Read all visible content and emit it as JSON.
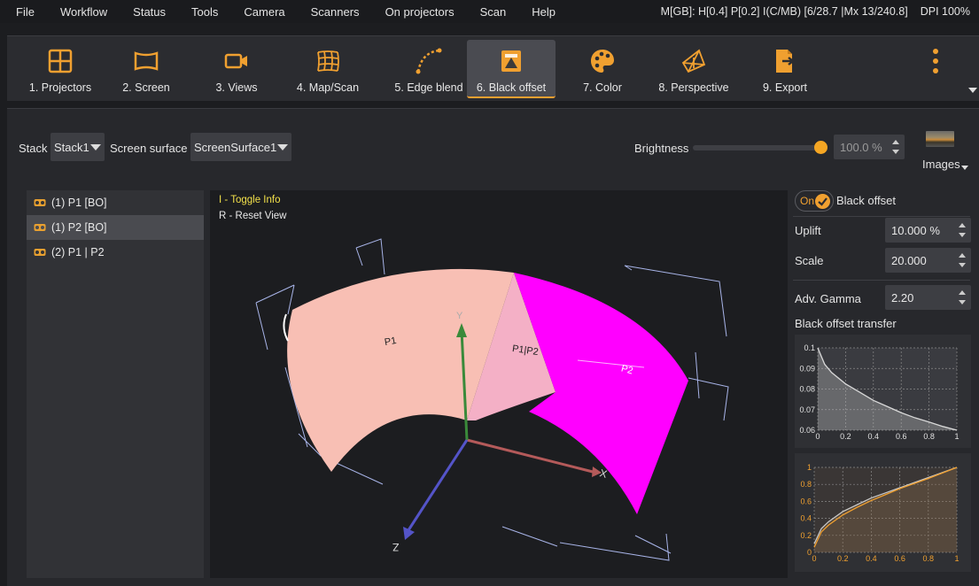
{
  "menu": [
    "File",
    "Workflow",
    "Status",
    "Tools",
    "Camera",
    "Scanners",
    "On projectors",
    "Scan",
    "Help"
  ],
  "stats": {
    "mem": "M[GB]: H[0.4] P[0.2] I(C/MB) [6/28.7 |Mx 13/240.8]",
    "dpi": "DPI 100%"
  },
  "tools": [
    {
      "label": "1. Projectors",
      "icon": "projectors-grid-icon"
    },
    {
      "label": "2. Screen",
      "icon": "screen-icon"
    },
    {
      "label": "3. Views",
      "icon": "video-camera-icon"
    },
    {
      "label": "4. Map/Scan",
      "icon": "mesh-grid-icon"
    },
    {
      "label": "5. Edge blend",
      "icon": "edge-blend-curve-icon"
    },
    {
      "label": "6. Black offset",
      "icon": "black-offset-icon"
    },
    {
      "label": "7. Color",
      "icon": "palette-icon"
    },
    {
      "label": "8. Perspective",
      "icon": "perspective-icon"
    },
    {
      "label": "9. Export",
      "icon": "export-icon"
    }
  ],
  "active_tool": 5,
  "stack": {
    "label": "Stack",
    "value": "Stack1"
  },
  "screen_surface": {
    "label": "Screen surface",
    "value": "ScreenSurface1"
  },
  "brightness": {
    "label": "Brightness",
    "value": "100.0 %",
    "level": 1.0
  },
  "images_label": "Images",
  "list_items": [
    "(1) P1 [BO]",
    "(1) P2 [BO]",
    "(2) P1 | P2"
  ],
  "selected_item": 1,
  "viewport": {
    "info1": "I - Toggle Info",
    "info2": "R - Reset View",
    "labels": [
      "P1",
      "P1|P2",
      "P2"
    ],
    "axes": [
      "Y",
      "X",
      "Z"
    ]
  },
  "black_offset": {
    "toggle": "On",
    "label": "Black offset"
  },
  "uplift": {
    "label": "Uplift",
    "value": "10.000 %"
  },
  "scale": {
    "label": "Scale",
    "value": "20.000"
  },
  "adv_gamma": {
    "label": "Adv. Gamma",
    "value": "2.20"
  },
  "transfer_title": "Black offset transfer",
  "colors": {
    "accent": "#f0a030",
    "p1": "#f8bfb4",
    "p12": "#f4b0c6",
    "p2": "#ff00ff"
  },
  "chart_data": [
    {
      "type": "line",
      "ylim": [
        0.06,
        0.1
      ],
      "xlim": [
        0,
        1
      ],
      "yticks": [
        "0.1",
        "0.09",
        "0.08",
        "0.07",
        "0.06"
      ],
      "xticks": [
        "0",
        "0.2",
        "0.4",
        "0.6",
        "0.8",
        "1"
      ],
      "x": [
        0,
        0.05,
        0.1,
        0.2,
        0.3,
        0.4,
        0.5,
        0.6,
        0.7,
        0.8,
        0.9,
        1
      ],
      "y": [
        0.1,
        0.092,
        0.088,
        0.0825,
        0.0785,
        0.0745,
        0.0715,
        0.0685,
        0.066,
        0.064,
        0.0618,
        0.06
      ]
    },
    {
      "type": "line",
      "ylim": [
        0,
        1
      ],
      "xlim": [
        0,
        1
      ],
      "yticks": [
        "1",
        "0.8",
        "0.6",
        "0.4",
        "0.2",
        "0"
      ],
      "xticks": [
        "0",
        "0.2",
        "0.4",
        "0.6",
        "0.8",
        "1"
      ],
      "series": [
        {
          "x": [
            0,
            0.05,
            0.1,
            0.2,
            0.3,
            0.4,
            0.5,
            0.6,
            0.7,
            0.8,
            0.9,
            1
          ],
          "y": [
            0.1,
            0.28,
            0.36,
            0.48,
            0.56,
            0.64,
            0.7,
            0.76,
            0.82,
            0.88,
            0.94,
            1
          ]
        },
        {
          "x": [
            0,
            0.05,
            0.1,
            0.2,
            0.3,
            0.4,
            0.5,
            0.6,
            0.7,
            0.8,
            0.9,
            1
          ],
          "y": [
            0.06,
            0.24,
            0.32,
            0.44,
            0.53,
            0.61,
            0.68,
            0.75,
            0.81,
            0.87,
            0.935,
            1
          ]
        }
      ]
    }
  ]
}
